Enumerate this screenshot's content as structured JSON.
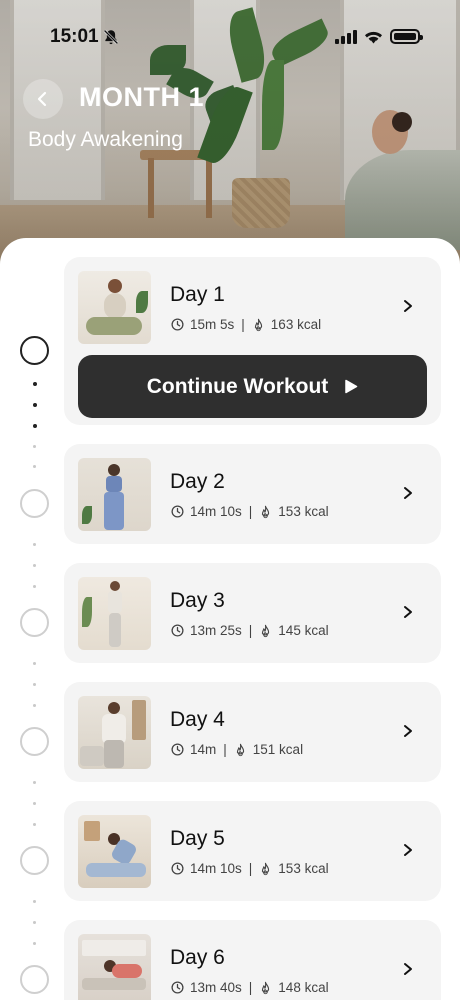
{
  "status_bar": {
    "time": "15:01"
  },
  "header": {
    "title": "MONTH 1",
    "subtitle": "Body Awakening"
  },
  "continue_label": "Continue Workout",
  "days": [
    {
      "label": "Day 1",
      "duration": "15m 5s",
      "calories": "163 kcal"
    },
    {
      "label": "Day 2",
      "duration": "14m 10s",
      "calories": "153 kcal"
    },
    {
      "label": "Day 3",
      "duration": "13m 25s",
      "calories": "145 kcal"
    },
    {
      "label": "Day 4",
      "duration": "14m",
      "calories": "151 kcal"
    },
    {
      "label": "Day 5",
      "duration": "14m 10s",
      "calories": "153 kcal"
    },
    {
      "label": "Day 6",
      "duration": "13m 40s",
      "calories": "148 kcal"
    }
  ],
  "separator": "|",
  "icons": {
    "back": "chevron-left-icon",
    "bell": "bell-slash-icon",
    "duration": "clock-icon",
    "calories": "flame-icon",
    "open": "chevron-right-icon",
    "play": "play-icon"
  },
  "colors": {
    "button": "#2f2f2f",
    "card": "#f4f4f4",
    "active_ring": "#222222",
    "inactive_ring": "#cfcfcf"
  }
}
